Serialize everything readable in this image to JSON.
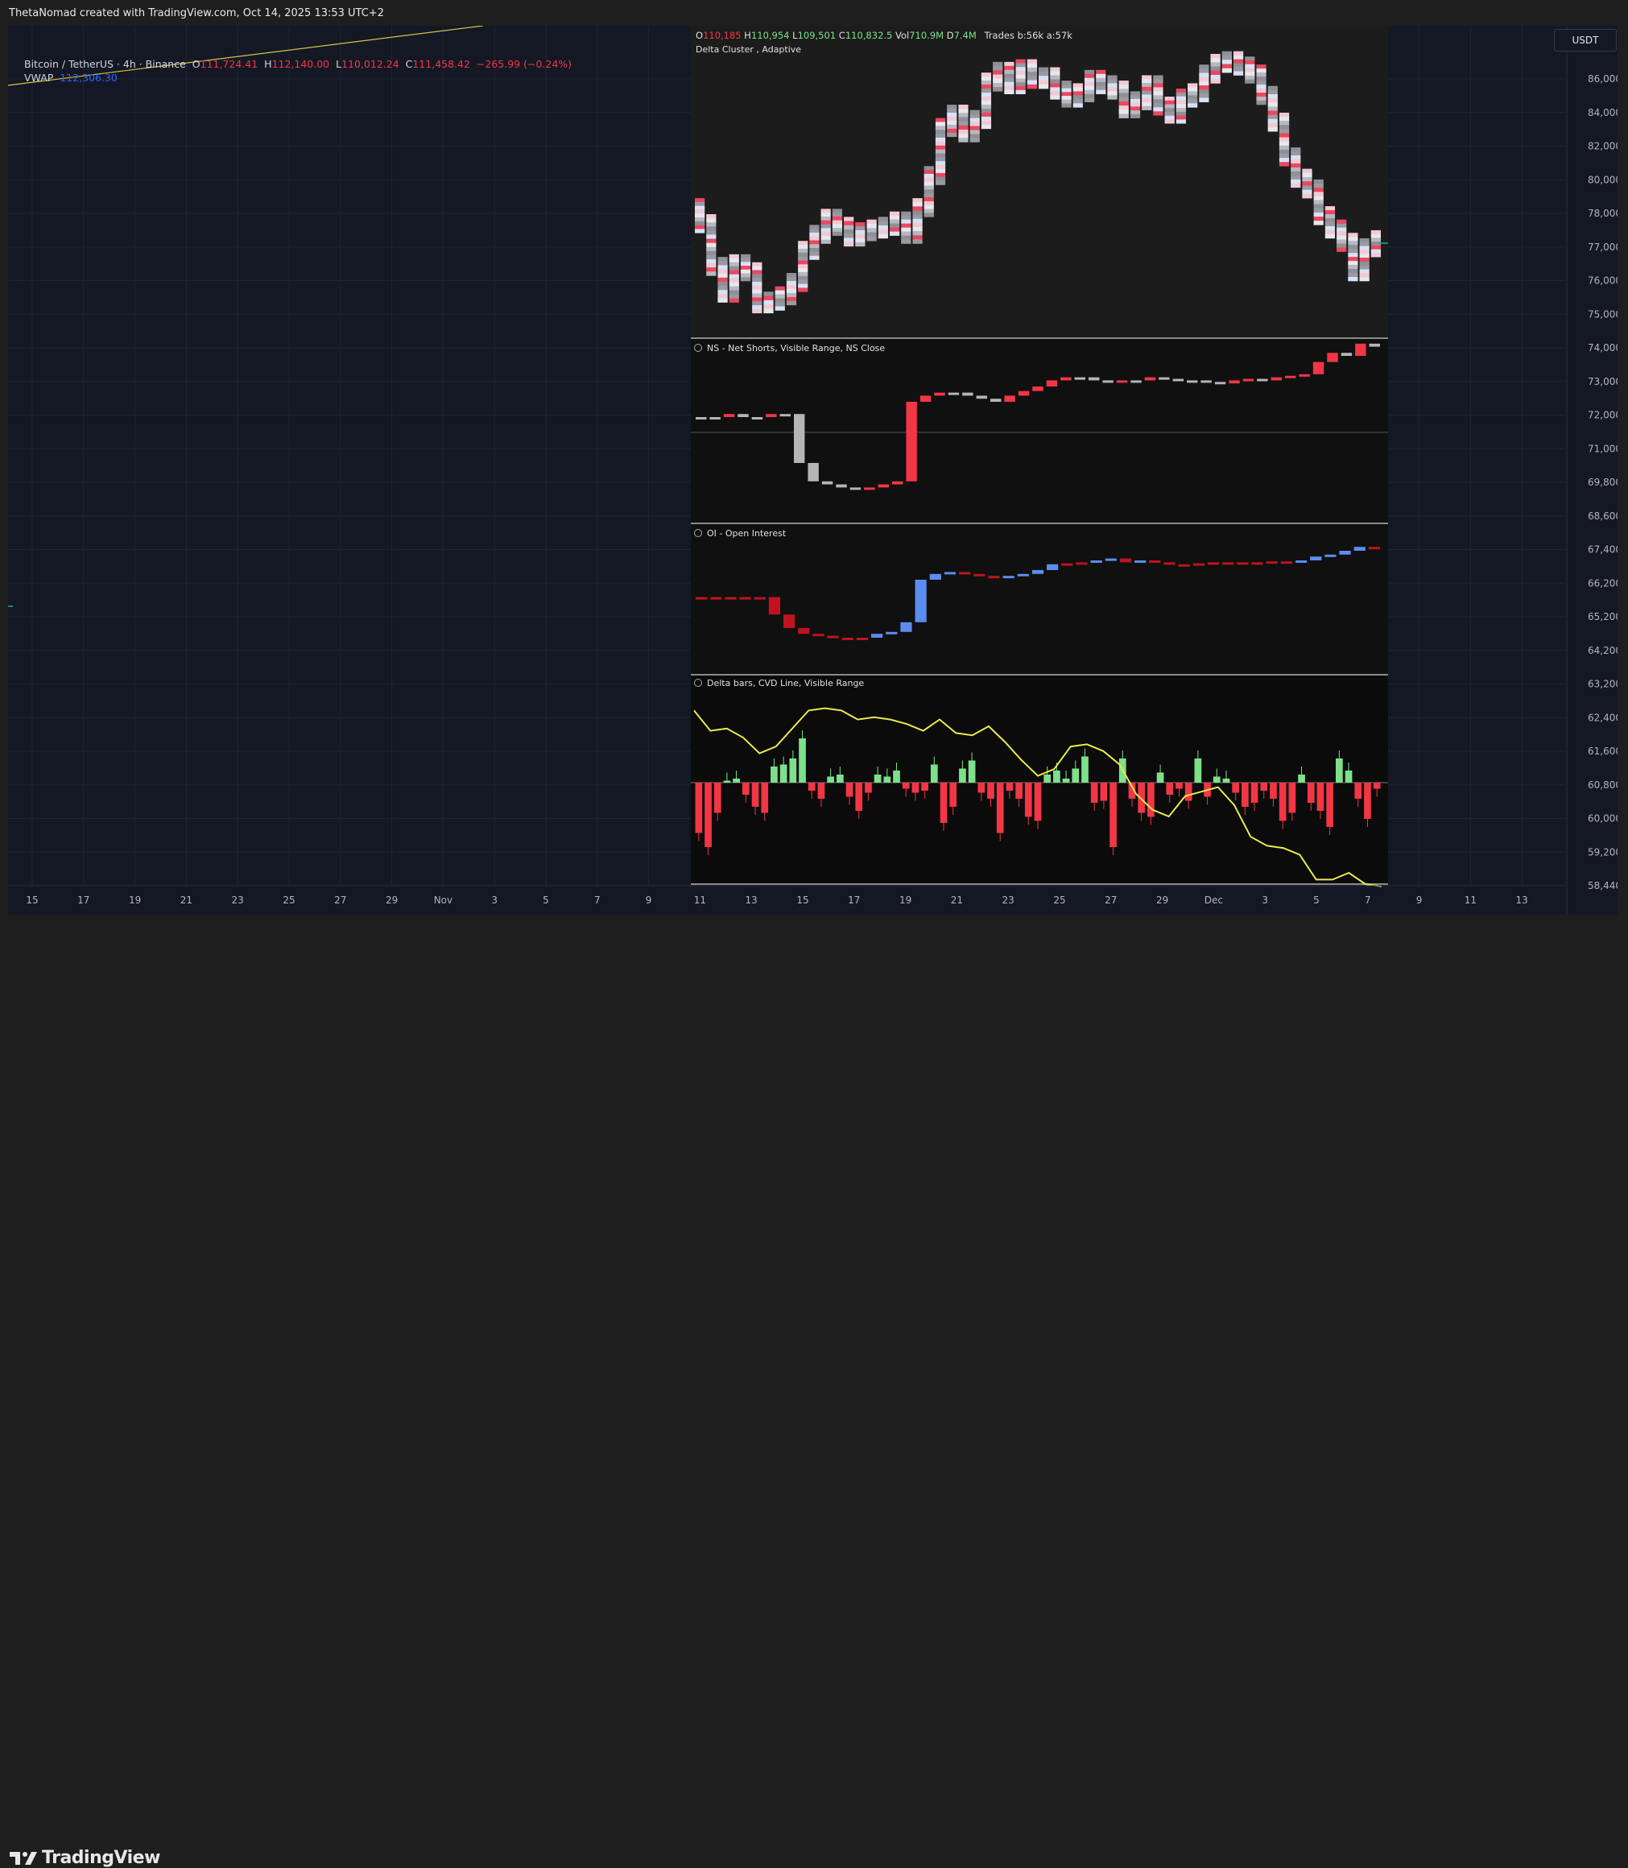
{
  "header": {
    "credit": "ThetaNomad created with TradingView.com, Oct 14, 2025 13:53 UTC+2"
  },
  "legend": {
    "symbol": "Bitcoin / TetherUS · 4h · Binance",
    "open_label": "O",
    "open": "111,724.41",
    "high_label": "H",
    "high": "112,140.00",
    "low_label": "L",
    "low": "110,012.24",
    "close_label": "C",
    "close": "111,458.42",
    "change": "−265.99 (−0.24%)",
    "vwap_label": "VWAP",
    "vwap": "112,306.30"
  },
  "currency_button": "USDT",
  "price_axis": [
    "86,000.00",
    "84,000.00",
    "82,000.00",
    "80,000.00",
    "78,000.00",
    "77,000.00",
    "76,000.00",
    "75,000.00",
    "74,000.00",
    "73,000.00",
    "72,000.00",
    "71,000.00",
    "69,800.00",
    "68,600.00",
    "67,400.00",
    "66,200.00",
    "65,200.00",
    "64,200.00",
    "63,200.00",
    "62,400.00",
    "61,600.00",
    "60,800.00",
    "60,000.00",
    "59,200.00",
    "58,440.00"
  ],
  "time_axis": [
    "15",
    "17",
    "19",
    "21",
    "23",
    "25",
    "27",
    "29",
    "Nov",
    "3",
    "5",
    "7",
    "9",
    "11",
    "13",
    "15",
    "17",
    "19",
    "21",
    "23",
    "25",
    "27",
    "29",
    "Dec",
    "3",
    "5",
    "7",
    "9",
    "11",
    "13"
  ],
  "overlay": {
    "ohlc": {
      "o_label": "O",
      "o": "110,185",
      "h_label": "H",
      "h": "110,954",
      "l_label": "L",
      "l": "109,501",
      "c_label": "C",
      "c": "110,832.5",
      "vol_label": "Vol",
      "vol": "710.9M",
      "d_label": "D",
      "d": "7.4M",
      "trades": "Trades b:56k a:57k"
    },
    "cluster_label": "Delta Cluster , Adaptive",
    "pane2_label": "NS - Net Shorts, Visible Range, NS Close",
    "pane3_label": "OI - Open Interest",
    "pane4_label": "Delta bars, CVD Line, Visible Range"
  },
  "brand": {
    "name": "TradingView"
  },
  "colors": {
    "up": "#26a69a",
    "down": "#f23645",
    "accent": "#2962ff",
    "vwap": "#2962ff",
    "ns_red": "#f23645",
    "oi_blue": "#5b8def",
    "oi_red": "#c0131f",
    "delta_green": "#7ee08a",
    "delta_red": "#f23645",
    "cvd": "#eaea4a",
    "chart_bg": "#141824"
  },
  "chart_data": [
    {
      "type": "bar",
      "title": "Delta Cluster , Adaptive",
      "note": "price candles (close values, USDT)",
      "values": [
        80200,
        78600,
        77600,
        78700,
        78400,
        77200,
        77300,
        77500,
        78000,
        79200,
        79800,
        80400,
        80100,
        79700,
        79900,
        80000,
        80100,
        80300,
        79800,
        80800,
        82000,
        83800,
        84300,
        83600,
        84100,
        85500,
        85900,
        85400,
        86000,
        85600,
        85700,
        85200,
        84900,
        85100,
        85600,
        85400,
        85200,
        84500,
        84800,
        85400,
        84600,
        84300,
        84900,
        85100,
        85800,
        86200,
        86300,
        86100,
        85800,
        85000,
        84000,
        82700,
        81900,
        81500,
        80500,
        80000,
        79500,
        78400,
        79300,
        79600
      ]
    },
    {
      "type": "bar",
      "title": "NS - Net Shorts, Visible Range, NS Close",
      "values": [
        0.5,
        0.5,
        0.6,
        0.5,
        0.5,
        0.6,
        0.6,
        -1.0,
        -1.6,
        -1.7,
        -1.8,
        -1.85,
        -1.8,
        -1.7,
        -1.6,
        1.0,
        1.2,
        1.3,
        1.3,
        1.2,
        1.1,
        1.0,
        1.2,
        1.35,
        1.5,
        1.7,
        1.8,
        1.8,
        1.7,
        1.65,
        1.7,
        1.7,
        1.8,
        1.75,
        1.7,
        1.7,
        1.65,
        1.6,
        1.7,
        1.75,
        1.7,
        1.8,
        1.85,
        1.9,
        2.3,
        2.6,
        2.5,
        2.9,
        2.8
      ]
    },
    {
      "type": "bar",
      "title": "OI - Open Interest",
      "values": [
        0.1,
        0.1,
        0.1,
        0.1,
        0.1,
        -0.8,
        -1.5,
        -1.8,
        -1.9,
        -2.0,
        -2.0,
        -2.0,
        -1.8,
        -1.7,
        -1.2,
        1.0,
        1.3,
        1.4,
        1.3,
        1.2,
        1.1,
        1.2,
        1.3,
        1.5,
        1.8,
        1.85,
        1.9,
        2.0,
        2.1,
        1.9,
        2.0,
        1.9,
        1.8,
        1.8,
        1.85,
        1.9,
        1.9,
        1.85,
        1.9,
        1.95,
        1.9,
        2.0,
        2.2,
        2.3,
        2.5,
        2.7,
        2.6
      ]
    },
    {
      "type": "bar",
      "title": "Delta bars, CVD Line, Visible Range",
      "values": [
        -2.5,
        -3.2,
        -1.5,
        0.1,
        0.2,
        -0.6,
        -1.2,
        -1.5,
        0.8,
        0.9,
        1.2,
        2.2,
        -0.4,
        -0.8,
        0.3,
        0.4,
        -0.7,
        -1.4,
        -0.5,
        0.4,
        0.3,
        0.6,
        -0.3,
        -0.5,
        -0.4,
        0.9,
        -2.0,
        -1.2,
        0.7,
        1.1,
        -0.5,
        -0.8,
        -2.5,
        -0.4,
        -0.8,
        -1.7,
        -1.9,
        0.4,
        0.6,
        0.2,
        0.7,
        1.3,
        -1.0,
        -0.9,
        -3.2,
        1.2,
        -0.8,
        -1.5,
        -1.7,
        0.5,
        -0.6,
        -0.3,
        -0.9,
        1.2,
        -0.7,
        0.3,
        0.2,
        -0.5,
        -1.2,
        -1.0,
        -0.4,
        -0.8,
        -1.9,
        -1.5,
        0.4,
        -1.0,
        -1.4,
        -2.2,
        1.2,
        0.6,
        -0.8,
        -1.8,
        -0.3
      ],
      "cvd": [
        3.2,
        2.3,
        2.4,
        2.0,
        1.3,
        1.6,
        2.4,
        3.2,
        3.3,
        3.2,
        2.8,
        2.9,
        2.8,
        2.6,
        2.3,
        2.8,
        2.2,
        2.1,
        2.5,
        1.8,
        1.0,
        0.3,
        0.6,
        1.6,
        1.7,
        1.4,
        0.8,
        -0.5,
        -1.2,
        -1.5,
        -0.6,
        -0.4,
        -0.2,
        -1.0,
        -2.4,
        -2.8,
        -2.9,
        -3.2,
        -4.3,
        -4.3,
        -4.0,
        -4.5,
        -4.6
      ]
    }
  ]
}
